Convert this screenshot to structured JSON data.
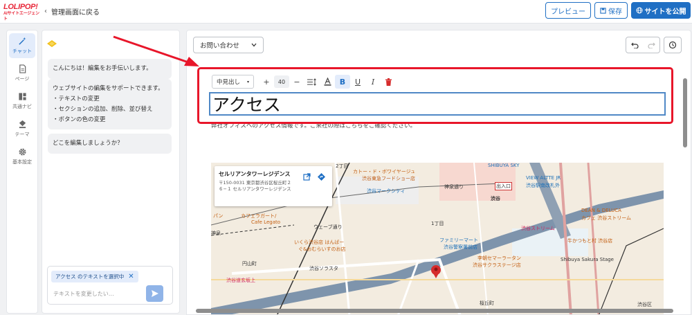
{
  "header": {
    "logo_main": "LOLIPOP!",
    "logo_sub": "AIサイトエージェント",
    "back_label": "管理画面に戻る",
    "preview_label": "プレビュー",
    "save_label": "保存",
    "publish_label": "サイトを公開"
  },
  "rail": [
    {
      "label": "チャット",
      "icon": "magic-wand-icon",
      "active": true
    },
    {
      "label": "ページ",
      "icon": "page-icon"
    },
    {
      "label": "共通ナビ",
      "icon": "layout-icon"
    },
    {
      "label": "テーマ",
      "icon": "paint-bucket-icon"
    },
    {
      "label": "基本設定",
      "icon": "gear-icon"
    }
  ],
  "chat": {
    "messages": [
      "こんにちは！編集をお手伝いします。",
      "ウェブサイトの編集をサポートできます。\n・テキストの変更\n・セクションの追加、削除、並び替え\n・ボタンの色の変更",
      "どこを編集しましょうか？"
    ],
    "chip_label": "アクセス のテキストを選択中",
    "input_placeholder": "テキストを変更したい…"
  },
  "editor": {
    "page_select": "お問い合わせ",
    "toolbar": {
      "style_select": "中見出し",
      "font_size": "40"
    },
    "heading": "アクセス",
    "description": "弊社オフィスへのアクセス情報です。ご来社の際はこちらをご確認ください。",
    "map": {
      "card_title": "セルリアンタワーレジデンス",
      "card_address": "〒150-0031 東京都渋谷区桜丘町２６−１ セルリアンタワーレジデンス",
      "labels": [
        {
          "text": "カトー・ド・ボワイヤージュ",
          "cls": "orange"
        },
        {
          "text": "渋谷東急フードショー店",
          "cls": "orange"
        },
        {
          "text": "渋谷マークシティ",
          "cls": "blue"
        },
        {
          "text": "神泉通り",
          "cls": "dark"
        },
        {
          "text": "SHIBUYA SKY",
          "cls": "blue"
        },
        {
          "text": "VIEW ALTTE JR",
          "cls": "blue"
        },
        {
          "text": "渋谷駅南改札外",
          "cls": "blue"
        },
        {
          "text": "出入口",
          "cls": "dark"
        },
        {
          "text": "渋谷",
          "cls": "dark"
        },
        {
          "text": "DEAN & DELUCA",
          "cls": "orange"
        },
        {
          "text": "カフェ 渋谷ストリーム",
          "cls": "orange"
        },
        {
          "text": "渋谷ストリーム",
          "cls": "pink"
        },
        {
          "text": "牛かつもと村 渋谷店",
          "cls": "orange"
        },
        {
          "text": "カフェラガート/",
          "cls": "orange"
        },
        {
          "text": "Cafe Legato",
          "cls": "orange"
        },
        {
          "text": "いくら渋谷店 はんばー",
          "cls": "orange"
        },
        {
          "text": "ぐ&おむらいすのお店",
          "cls": "orange"
        },
        {
          "text": "ファミリーマート",
          "cls": "blue"
        },
        {
          "text": "渋谷警察署前店",
          "cls": "blue"
        },
        {
          "text": "李朝セマーラータン",
          "cls": "orange"
        },
        {
          "text": "渋谷サクラステージ店",
          "cls": "orange"
        },
        {
          "text": "Shibuya Sakura Stage",
          "cls": "dark"
        },
        {
          "text": "渋谷ソラスタ",
          "cls": "dark"
        },
        {
          "text": "円山町",
          "cls": "dark"
        },
        {
          "text": "渋谷道玄坂上",
          "cls": "pink"
        },
        {
          "text": "桜丘町",
          "cls": "dark"
        },
        {
          "text": "ウェーブ通り",
          "cls": "dark"
        },
        {
          "text": "1丁目",
          "cls": "dark"
        },
        {
          "text": "2丁目",
          "cls": "dark"
        },
        {
          "text": "パン",
          "cls": "orange"
        },
        {
          "text": "神泉",
          "cls": "dark"
        },
        {
          "text": "渋谷区",
          "cls": "dark"
        }
      ]
    }
  }
}
